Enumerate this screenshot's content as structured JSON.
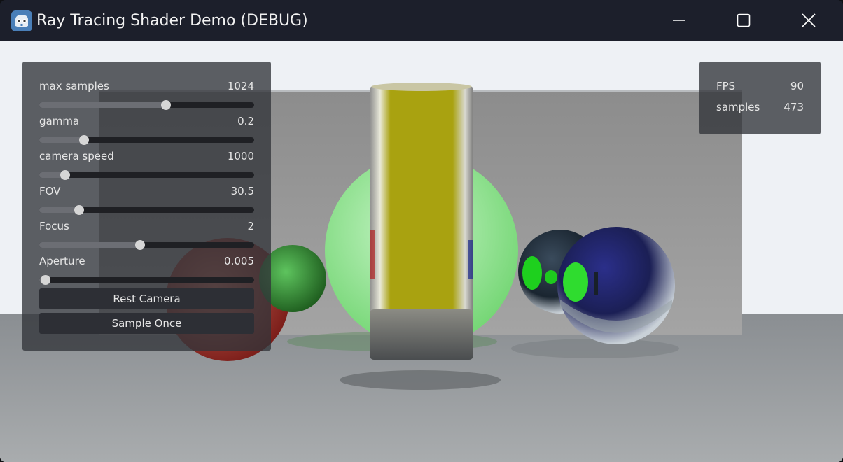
{
  "window": {
    "title": "Ray Tracing Shader Demo (DEBUG)",
    "app_icon": "godot-engine-icon",
    "controls": {
      "minimize_icon": "minimize-icon",
      "maximize_icon": "maximize-icon",
      "close_icon": "close-icon"
    }
  },
  "settings_panel": {
    "rows": [
      {
        "label": "max samples",
        "value": "1024",
        "slider_fraction": 0.59
      },
      {
        "label": "gamma",
        "value": "0.2",
        "slider_fraction": 0.21
      },
      {
        "label": "camera speed",
        "value": "1000",
        "slider_fraction": 0.12
      },
      {
        "label": "FOV",
        "value": "30.5",
        "slider_fraction": 0.185
      },
      {
        "label": "Focus",
        "value": "2",
        "slider_fraction": 0.47
      },
      {
        "label": "Aperture",
        "value": "0.005",
        "slider_fraction": 0.03
      }
    ],
    "buttons": {
      "reset_camera": "Rest Camera",
      "sample_once": "Sample Once"
    }
  },
  "stats_panel": {
    "fps_label": "FPS",
    "fps_value": "90",
    "samples_label": "samples",
    "samples_value": "473"
  },
  "colors": {
    "titlebar": "#1c1f2b",
    "panel_bg": "rgba(50,52,58,0.78)",
    "slider_track": "#1f2024",
    "slider_fill": "#6c6e74",
    "slider_thumb": "#d6d6d6",
    "button_bg": "#2d2f35"
  }
}
